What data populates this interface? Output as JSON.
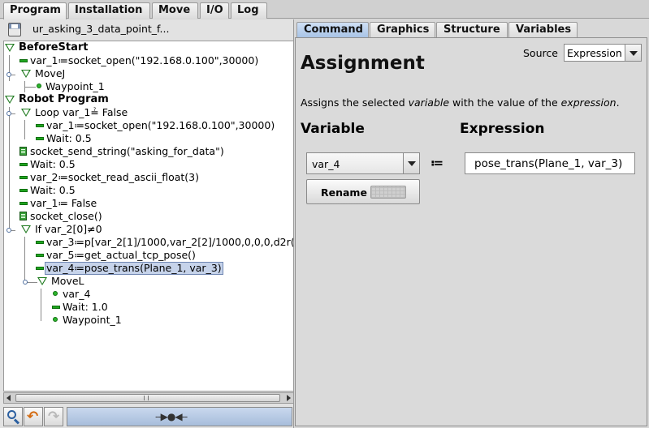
{
  "top_tabs": [
    {
      "label": "Program"
    },
    {
      "label": "Installation"
    },
    {
      "label": "Move"
    },
    {
      "label": "I/O"
    },
    {
      "label": "Log"
    }
  ],
  "file": {
    "name": "ur_asking_3_data_point_f..."
  },
  "tree": {
    "before_start": "BeforeStart",
    "bs_var1": "var_1≔socket_open(\"192.168.0.100\",30000)",
    "bs_movej": "MoveJ",
    "bs_waypoint1": "Waypoint_1",
    "robot_program": "Robot Program",
    "loop": "Loop var_1≟ False",
    "loop_var1": "var_1≔socket_open(\"192.168.0.100\",30000)",
    "loop_wait": "Wait: 0.5",
    "send_string": "socket_send_string(\"asking_for_data\")",
    "wait1": "Wait: 0.5",
    "var2": "var_2≔socket_read_ascii_float(3)",
    "wait2": "Wait: 0.5",
    "var1_false": "var_1≔ False",
    "close": "socket_close()",
    "if": "If var_2[0]≠0",
    "var3": "var_3≔p[var_2[1]/1000,var_2[2]/1000,0,0,0,d2r(",
    "var5": "var_5≔get_actual_tcp_pose()",
    "var4": "var_4≔pose_trans(Plane_1, var_3)",
    "movel": "MoveL",
    "ml_var4": "var_4",
    "ml_wait": "Wait: 1.0",
    "ml_waypoint1": "Waypoint_1"
  },
  "right_tabs": [
    {
      "label": "Command"
    },
    {
      "label": "Graphics"
    },
    {
      "label": "Structure"
    },
    {
      "label": "Variables"
    }
  ],
  "command": {
    "title": "Assignment",
    "source_label": "Source",
    "source_value": "Expression",
    "desc_prefix": "Assigns the selected ",
    "desc_var": "variable",
    "desc_mid": " with the value of the ",
    "desc_expr": "expression",
    "desc_suffix": ".",
    "variable_header": "Variable",
    "expression_header": "Expression",
    "variable_value": "var_4",
    "assign_operator": "≔",
    "expression_value": "pose_trans(Plane_1, var_3)",
    "rename_label": "Rename"
  },
  "colors": {
    "active_tab": "#a9c4e6",
    "selection": "#c6d3ea",
    "tree_green": "#1fa51f"
  }
}
